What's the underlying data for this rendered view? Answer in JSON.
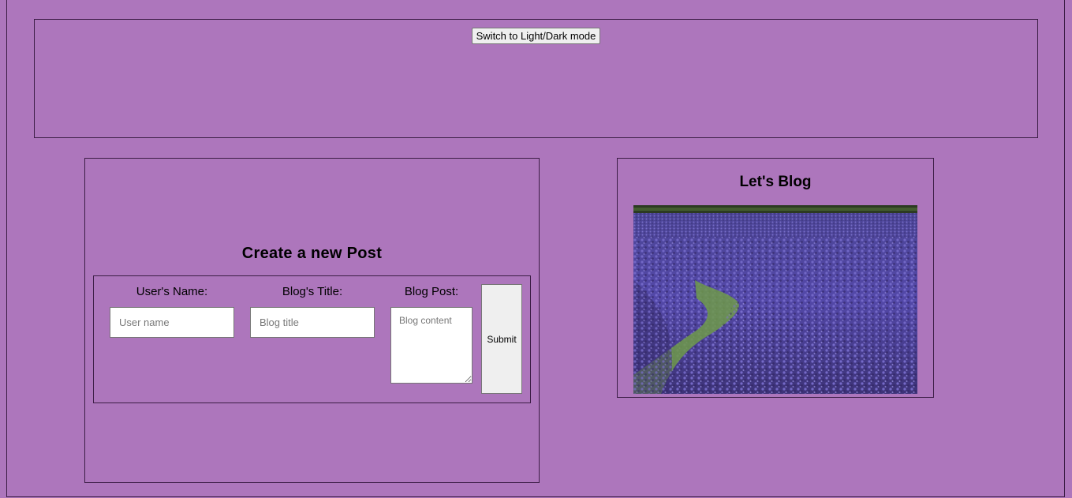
{
  "header": {
    "mode_button_label": "Switch to Light/Dark mode"
  },
  "post_form": {
    "heading": "Create a new Post",
    "user_name": {
      "label": "User's Name:",
      "placeholder": "User name",
      "value": ""
    },
    "blog_title": {
      "label": "Blog's Title:",
      "placeholder": "Blog title",
      "value": ""
    },
    "blog_post": {
      "label": "Blog Post:",
      "placeholder": "Blog content",
      "value": ""
    },
    "submit_label": "Submit"
  },
  "blog_panel": {
    "heading": "Let's Blog",
    "image_subject": "lavender-field-photo"
  },
  "colors": {
    "background": "#ad76bc",
    "border": "#3b1d45",
    "button_face": "#efefef",
    "lavender_dark": "#4a3a8c",
    "lavender_light": "#6b5cc4",
    "grass": "#6f9a4a"
  }
}
